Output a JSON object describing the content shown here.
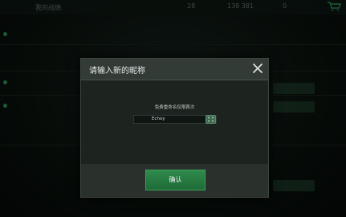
{
  "background": {
    "title": "我的战绩",
    "stats": [
      "28",
      "138 381",
      "0"
    ]
  },
  "dialog": {
    "title": "请输入新的昵称",
    "prompt": "免费重命名仅限首次",
    "name_value": "Echoy",
    "confirm_label": "确认"
  },
  "colors": {
    "accent": "#2f8a4b",
    "dialog_bg": "#262d29",
    "header_bg": "#333b37"
  },
  "icons": {
    "close": "close-icon",
    "random": "random-name-icon"
  }
}
